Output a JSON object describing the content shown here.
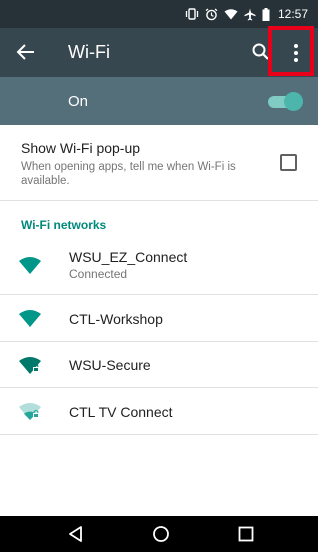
{
  "status_bar": {
    "time": "12:57",
    "icons": [
      "vibrate-icon",
      "alarm-icon",
      "wifi-signal-icon",
      "airplane-icon",
      "battery-icon"
    ]
  },
  "toolbar": {
    "title": "Wi-Fi",
    "back_icon": "back-arrow-icon",
    "search_icon": "search-icon",
    "more_icon": "more-vert-icon"
  },
  "master_switch": {
    "label": "On",
    "enabled": true
  },
  "popup_setting": {
    "title": "Show Wi-Fi pop-up",
    "description": "When opening apps, tell me when Wi-Fi is available.",
    "checked": false
  },
  "networks_header": "Wi-Fi networks",
  "networks": [
    {
      "name": "WSU_EZ_Connect",
      "status": "Connected",
      "icon": "wifi-full-icon"
    },
    {
      "name": "CTL-Workshop",
      "status": "",
      "icon": "wifi-full-icon"
    },
    {
      "name": "WSU-Secure",
      "status": "",
      "icon": "wifi-locked-icon"
    },
    {
      "name": "CTL TV Connect",
      "status": "",
      "icon": "wifi-weak-locked-icon"
    }
  ],
  "nav_bar": {
    "icons": [
      "nav-back-icon",
      "nav-home-icon",
      "nav-recents-icon"
    ]
  },
  "colors": {
    "status_bar": "#263238",
    "toolbar": "#37474f",
    "switch_bar": "#546e7a",
    "accent": "#00897b",
    "highlight": "#e8001a"
  }
}
